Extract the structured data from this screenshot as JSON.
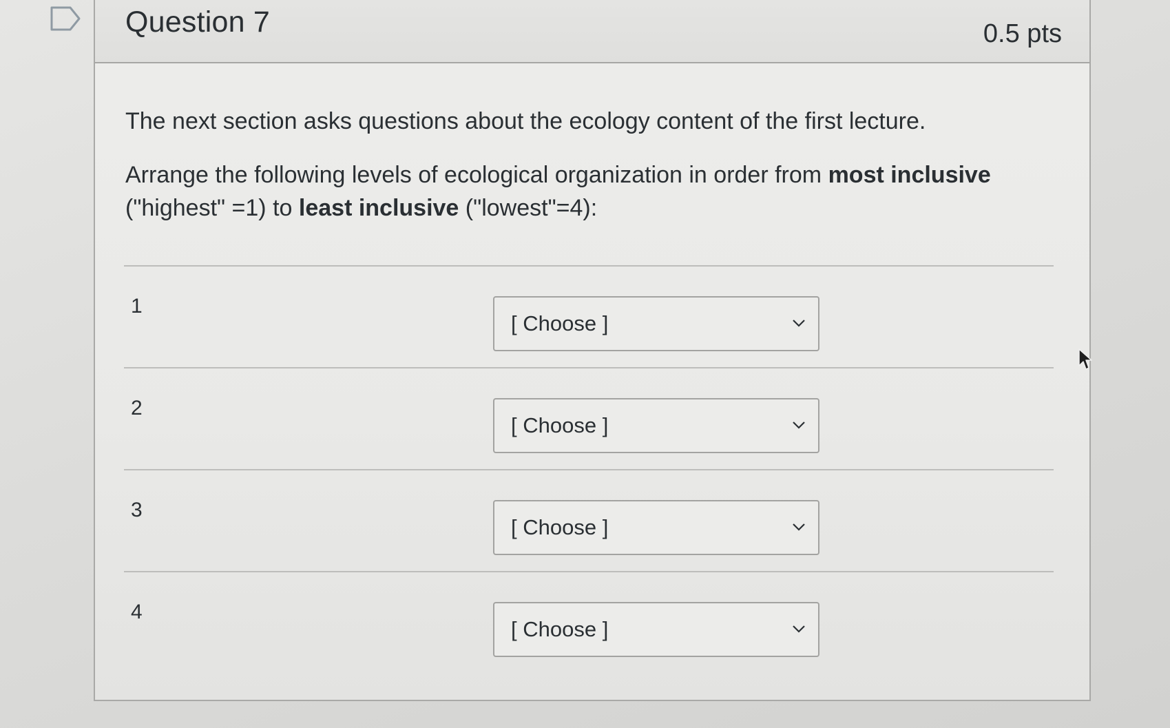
{
  "question": {
    "title": "Question 7",
    "points": "0.5 pts",
    "intro": "The next section asks questions about the ecology content of the first lecture.",
    "instruction_part1": "Arrange the following levels of ecological organization in order from ",
    "instruction_bold1": "most inclusive",
    "instruction_part2": " (\"highest\" =1) to ",
    "instruction_bold2": "least inclusive",
    "instruction_part3": " (\"lowest\"=4):"
  },
  "rows": [
    {
      "label": "1",
      "select": "[ Choose ]"
    },
    {
      "label": "2",
      "select": "[ Choose ]"
    },
    {
      "label": "3",
      "select": "[ Choose ]"
    },
    {
      "label": "4",
      "select": "[ Choose ]"
    }
  ],
  "icons": {
    "flag": "flag-bookmark-icon",
    "chevron": "chevron-down-icon",
    "cursor": "mouse-pointer-icon"
  }
}
